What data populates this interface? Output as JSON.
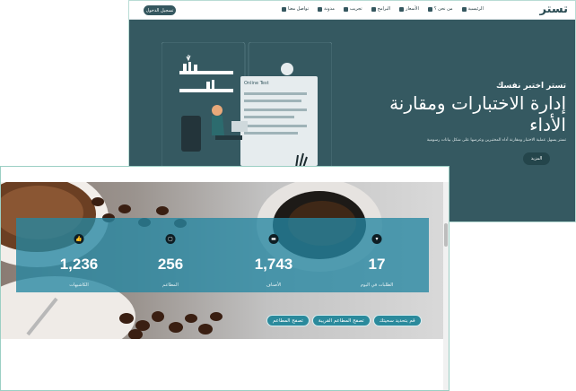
{
  "back": {
    "logo": "تستر",
    "login_button": "تسجيل الدخول",
    "menu": [
      {
        "label": "الرئيسية",
        "icon": "home-icon"
      },
      {
        "label": "من نحن ؟",
        "icon": "users-icon"
      },
      {
        "label": "الأسعار",
        "icon": "tag-icon"
      },
      {
        "label": "البرامج",
        "icon": "grid-icon"
      },
      {
        "label": "تجريب",
        "icon": "edit-icon"
      },
      {
        "label": "مدونة",
        "icon": "book-icon"
      },
      {
        "label": "تواصل معنا",
        "icon": "phone-icon"
      }
    ],
    "hero": {
      "title": "تستر اختبر نفسك",
      "heading": "إدارة الاختبارات ومقارنة الأداء",
      "description": "تستر يسهل عملية الاختبار ومقارنة أداء المختبرين وعرضها على شكل بيانات رسومية",
      "more_button": "المزيد",
      "illustration_label": "Online Test"
    }
  },
  "front": {
    "stats": [
      {
        "value": "1,236",
        "label": "الكاشيهات",
        "icon": "thumbs-up-icon"
      },
      {
        "value": "256",
        "label": "المطاعم",
        "icon": "store-icon"
      },
      {
        "value": "1,743",
        "label": "الأصناف",
        "icon": "menu-icon"
      },
      {
        "value": "17",
        "label": "الطلبات في اليوم",
        "icon": "trophy-icon"
      }
    ],
    "buttons": [
      "قم بتحديد سحيتك",
      "تصفح المطاعم القريبة",
      "تصفح المطاعم"
    ]
  }
}
